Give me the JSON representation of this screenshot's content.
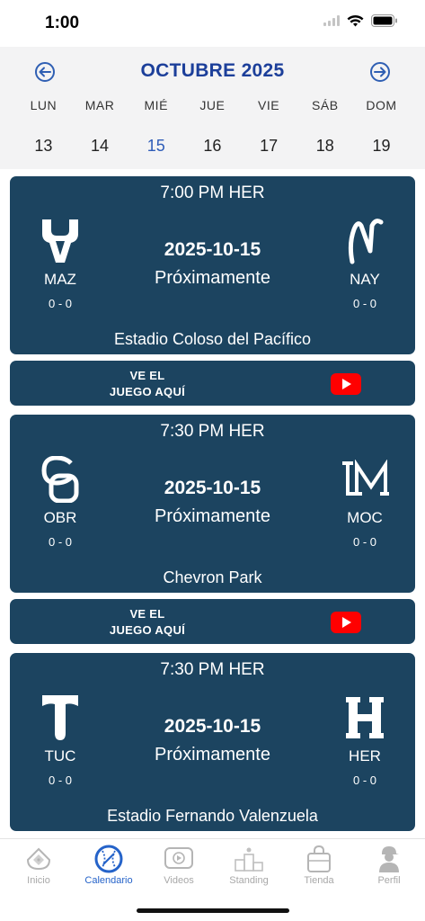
{
  "status_bar": {
    "time": "1:00"
  },
  "calendar": {
    "month_title": "OCTUBRE 2025",
    "weekdays": [
      "LUN",
      "MAR",
      "MIÉ",
      "JUE",
      "VIE",
      "SÁB",
      "DOM"
    ],
    "days": [
      "13",
      "14",
      "15",
      "16",
      "17",
      "18",
      "19"
    ],
    "selected_day": "15"
  },
  "games": [
    {
      "time": "7:00 PM HER",
      "date": "2025-10-15",
      "status": "Próximamente",
      "home": {
        "code": "MAZ",
        "record": "0 - 0",
        "logo": "maz-logo"
      },
      "away": {
        "code": "NAY",
        "record": "0 - 0",
        "logo": "nay-logo"
      },
      "venue": "Estadio Coloso del Pacífico",
      "watch": {
        "line1": "VE EL",
        "line2": "JUEGO AQUÍ"
      }
    },
    {
      "time": "7:30 PM HER",
      "date": "2025-10-15",
      "status": "Próximamente",
      "home": {
        "code": "OBR",
        "record": "0 - 0",
        "logo": "obr-logo"
      },
      "away": {
        "code": "MOC",
        "record": "0 - 0",
        "logo": "moc-logo"
      },
      "venue": "Chevron Park",
      "watch": {
        "line1": "VE EL",
        "line2": "JUEGO AQUÍ"
      }
    },
    {
      "time": "7:30 PM HER",
      "date": "2025-10-15",
      "status": "Próximamente",
      "home": {
        "code": "TUC",
        "record": "0 - 0",
        "logo": "tuc-logo"
      },
      "away": {
        "code": "HER",
        "record": "0 - 0",
        "logo": "her-logo"
      },
      "venue": "Estadio Fernando Valenzuela"
    }
  ],
  "tabs": [
    {
      "label": "Inicio",
      "icon": "baseball-field-icon"
    },
    {
      "label": "Calendario",
      "icon": "baseball-icon",
      "active": true
    },
    {
      "label": "Videos",
      "icon": "play-video-icon"
    },
    {
      "label": "Standing",
      "icon": "podium-icon"
    },
    {
      "label": "Tienda",
      "icon": "shopping-bag-icon"
    },
    {
      "label": "Perfil",
      "icon": "player-profile-icon"
    }
  ],
  "colors": {
    "card": "#1c4460",
    "accent": "#1c3f9a",
    "active_tab": "#2563c9",
    "inactive_tab": "#a8a8a8"
  }
}
